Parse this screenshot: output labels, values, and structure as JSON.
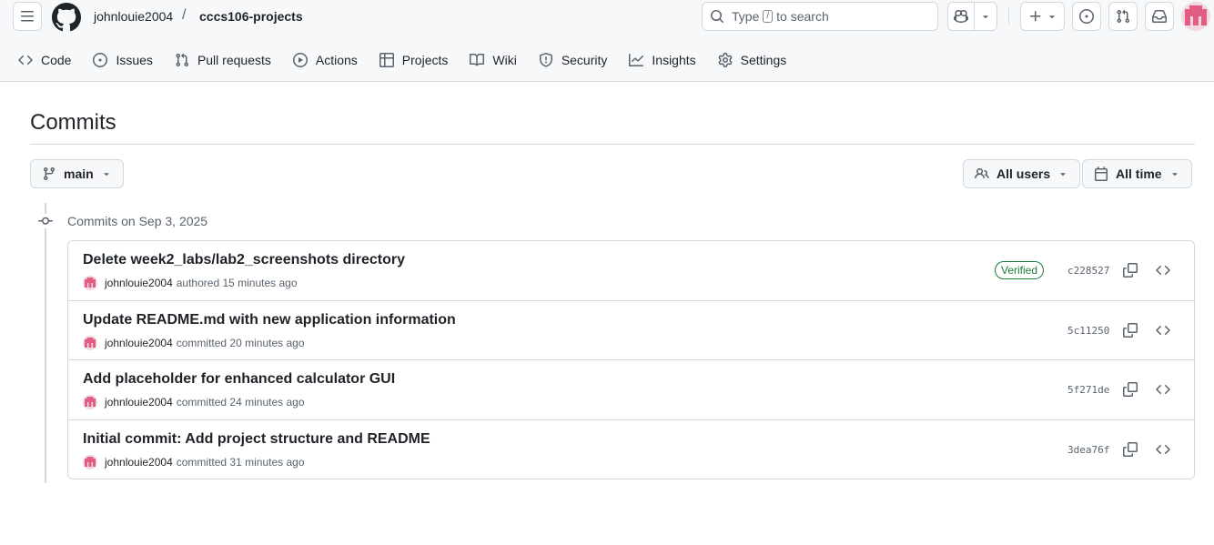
{
  "header": {
    "owner": "johnlouie2004",
    "separator": "/",
    "repo": "cccs106-projects",
    "search": {
      "prefix": "Type",
      "key": "/",
      "suffix": "to search"
    },
    "icons": [
      "menu-icon",
      "github-logo",
      "search-icon",
      "copilot-icon",
      "plus-icon",
      "issue-icon",
      "pull-request-icon",
      "inbox-icon"
    ]
  },
  "tabs": [
    {
      "label": "Code",
      "icon": "code-icon"
    },
    {
      "label": "Issues",
      "icon": "issue-opened-icon"
    },
    {
      "label": "Pull requests",
      "icon": "git-pull-request-icon"
    },
    {
      "label": "Actions",
      "icon": "play-icon"
    },
    {
      "label": "Projects",
      "icon": "table-icon"
    },
    {
      "label": "Wiki",
      "icon": "book-icon"
    },
    {
      "label": "Security",
      "icon": "shield-icon"
    },
    {
      "label": "Insights",
      "icon": "graph-icon"
    },
    {
      "label": "Settings",
      "icon": "gear-icon"
    }
  ],
  "page": {
    "title": "Commits",
    "branch": "main",
    "users_filter": "All users",
    "time_filter": "All time",
    "group_label": "Commits on Sep 3, 2025"
  },
  "commits": [
    {
      "message": "Delete week2_labs/lab2_screenshots directory",
      "author": "johnlouie2004",
      "action": "authored 15 minutes ago",
      "verified": "Verified",
      "sha": "c228527"
    },
    {
      "message": "Update README.md with new application information",
      "author": "johnlouie2004",
      "action": "committed 20 minutes ago",
      "verified": "",
      "sha": "5c11250"
    },
    {
      "message": "Add placeholder for enhanced calculator GUI",
      "author": "johnlouie2004",
      "action": "committed 24 minutes ago",
      "verified": "",
      "sha": "5f271de"
    },
    {
      "message": "Initial commit: Add project structure and README",
      "author": "johnlouie2004",
      "action": "committed 31 minutes ago",
      "verified": "",
      "sha": "3dea76f"
    }
  ],
  "colors": {
    "accent_green": "#1a7f37",
    "avatar_pink": "#e35d83",
    "border": "#d1d9e0"
  }
}
